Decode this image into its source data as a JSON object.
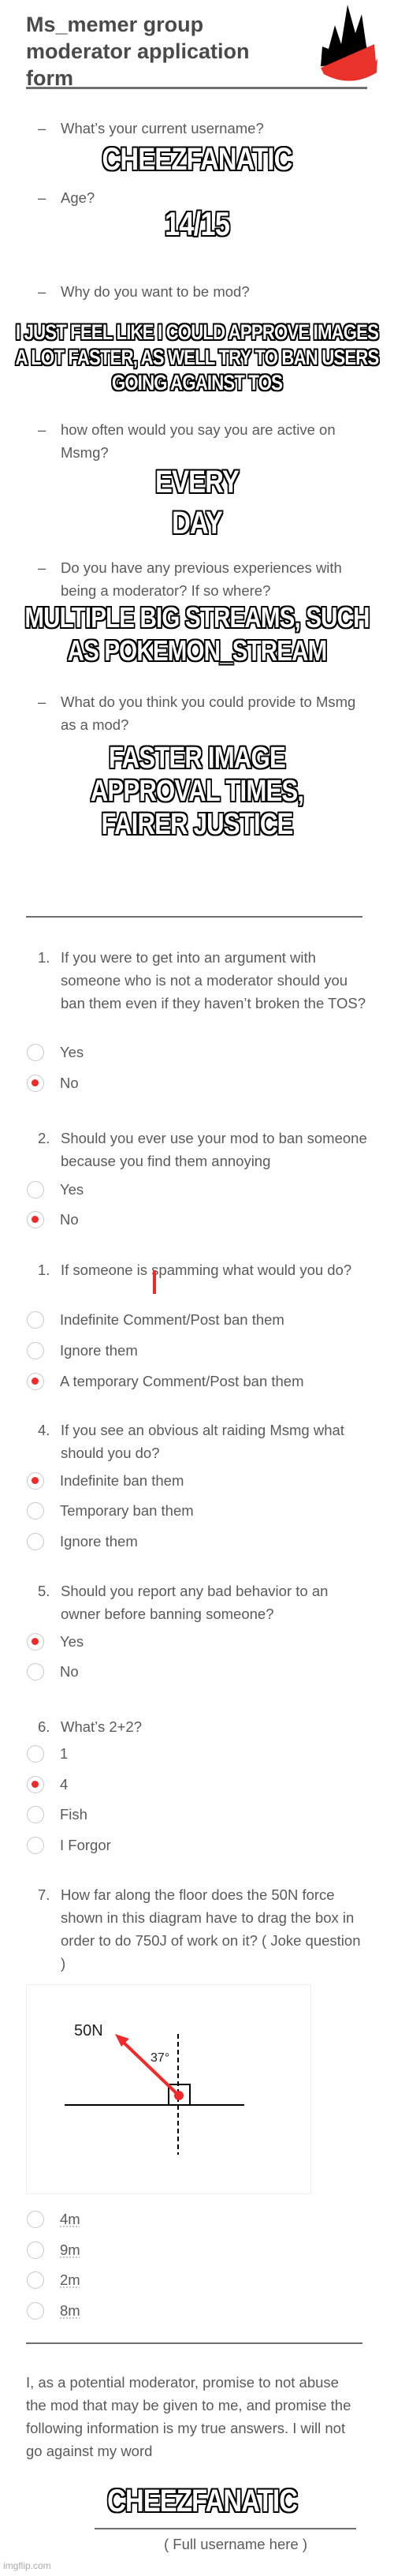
{
  "header": {
    "title": "Ms_memer group moderator application form",
    "logo": "black-red-flame-logo"
  },
  "section1": {
    "questions": [
      {
        "prefix": "–",
        "text": "What’s your current username?",
        "answer": "CHEEZFANATIC"
      },
      {
        "prefix": "–",
        "text": "Age?",
        "answer": "14/15"
      },
      {
        "prefix": "–",
        "text": "Why do you want to be mod?",
        "answer": "I JUST FEEL LIKE I COULD APPROVE IMAGES A LOT FASTER, AS WELL TRY TO BAN USERS GOING AGAINST TOS"
      },
      {
        "prefix": "–",
        "text": "how often would you say you are active on Msmg?",
        "answer": "EVERY DAY"
      },
      {
        "prefix": "–",
        "text": "Do you have any previous experiences with being a moderator? If so where?",
        "answer": "MULTIPLE BIG STREAMS, SUCH AS POKEMON_STREAM"
      },
      {
        "prefix": "–",
        "text": "What do you think you could provide to Msmg as a mod?",
        "answer": "FASTER IMAGE APPROVAL TIMES, FAIRER JUSTICE"
      }
    ]
  },
  "section2": {
    "questions": [
      {
        "number": "1.",
        "text": "If you were to get into an argument with someone who is not a moderator should you ban them even if they haven’t broken the TOS?",
        "options": [
          {
            "label": "Yes",
            "selected": false
          },
          {
            "label": "No",
            "selected": true
          }
        ]
      },
      {
        "number": "2.",
        "text": "Should you ever use your mod to ban someone because you find them annoying",
        "options": [
          {
            "label": "Yes",
            "selected": false
          },
          {
            "label": "No",
            "selected": true
          }
        ]
      },
      {
        "number": "1.",
        "text": "If someone is spamming what would you do?",
        "options": [
          {
            "label": "Indefinite Comment/Post ban them",
            "selected": false
          },
          {
            "label": "Ignore them",
            "selected": false
          },
          {
            "label": "A temporary Comment/Post ban them",
            "selected": true
          }
        ]
      },
      {
        "number": "4.",
        "text": "If you see an obvious alt raiding Msmg what should you do?",
        "options": [
          {
            "label": "Indefinite ban them",
            "selected": true
          },
          {
            "label": "Temporary ban them",
            "selected": false
          },
          {
            "label": "Ignore them",
            "selected": false
          }
        ]
      },
      {
        "number": "5.",
        "text": "Should you report any bad behavior to an owner before banning someone?",
        "options": [
          {
            "label": "Yes",
            "selected": true
          },
          {
            "label": "No",
            "selected": false
          }
        ]
      },
      {
        "number": "6.",
        "text": "What’s 2+2?",
        "options": [
          {
            "label": "1",
            "selected": false
          },
          {
            "label": "4",
            "selected": true
          },
          {
            "label": "Fish",
            "selected": false
          },
          {
            "label": "I Forgor",
            "selected": false
          }
        ]
      },
      {
        "number": "7.",
        "text": "How far along the floor does the 50N force shown in this diagram have to drag the box in order to do 750J of work on it? ( Joke question )",
        "diagram": {
          "force_label": "50N",
          "angle_label": "37°"
        },
        "options": [
          {
            "label": "4m",
            "selected": false
          },
          {
            "label": "9m",
            "selected": false
          },
          {
            "label": "2m",
            "selected": false
          },
          {
            "label": "8m",
            "selected": false
          }
        ]
      }
    ]
  },
  "pledge": {
    "text": "I, as a potential moderator, promise to not abuse the mod that may be given to me, and promise the following information is my true answers. I will not go against my word",
    "signature": "CHEEZFANATIC",
    "signature_caption": "( Full username here )"
  },
  "watermark": "imgflip.com",
  "colors": {
    "accent": "#f02a2a",
    "text": "#5a5a5a",
    "rule": "#6e6e6e"
  }
}
